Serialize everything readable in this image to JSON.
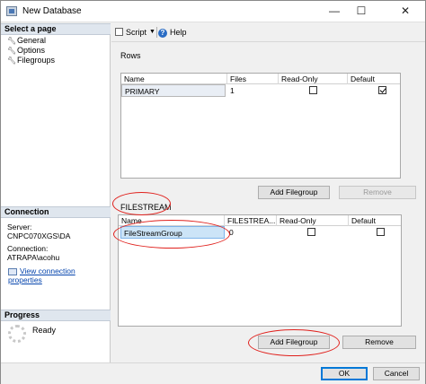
{
  "window": {
    "title": "New Database",
    "controls": {
      "minimize": "—",
      "maximize": "☐",
      "close": "✕"
    }
  },
  "sidebar": {
    "select_page_header": "Select a page",
    "pages": [
      {
        "label": "General",
        "icon": "wrench-icon"
      },
      {
        "label": "Options",
        "icon": "wrench-icon"
      },
      {
        "label": "Filegroups",
        "icon": "wrench-icon"
      }
    ],
    "connection": {
      "header": "Connection",
      "server_label": "Server:",
      "server_value": "CNPC070XGS\\DA",
      "connection_label": "Connection:",
      "connection_value": "ATRAPA\\acohu",
      "view_properties_link": "View connection properties"
    },
    "progress": {
      "header": "Progress",
      "status": "Ready"
    }
  },
  "toolbar": {
    "script_label": "Script",
    "script_dropdown": "▼",
    "help_label": "Help"
  },
  "rows_section": {
    "label": "Rows",
    "columns": [
      "Name",
      "Files",
      "Read-Only",
      "Default"
    ],
    "rows": [
      {
        "name": "PRIMARY",
        "files": "1",
        "read_only": false,
        "default": true
      }
    ],
    "add_button": "Add Filegroup",
    "remove_button": "Remove"
  },
  "filestream_section": {
    "label": "FILESTREAM",
    "columns": [
      "Name",
      "FILESTREA...",
      "Read-Only",
      "Default"
    ],
    "rows": [
      {
        "name": "FileStreamGroup",
        "files": "0",
        "read_only": false,
        "default": false
      }
    ],
    "add_button": "Add Filegroup",
    "remove_button": "Remove"
  },
  "footer": {
    "ok_button": "OK",
    "cancel_button": "Cancel"
  },
  "colors": {
    "annotation": "#e0201c",
    "link": "#0645ad",
    "selection": "#cce4f7"
  }
}
